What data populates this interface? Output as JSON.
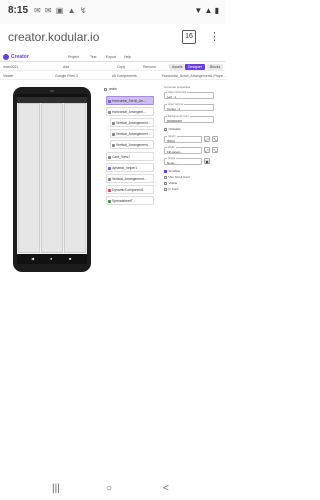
{
  "status_bar": {
    "time": "8:15",
    "left_icons": "✉ ✉ ▣ ▲ ↯",
    "right_icons": "▼ ▲ ▮"
  },
  "browser": {
    "url": "creator.kodular.io",
    "tab_count": "16",
    "more": "⋮"
  },
  "app": {
    "logo_text": "Creator",
    "menu": [
      "Project",
      "Test",
      "Export",
      "Help"
    ]
  },
  "toolbar": {
    "screen": "main2021",
    "items": [
      "Add",
      "Copy",
      "Remove"
    ],
    "buttons": [
      "Assets",
      "Designer",
      "Blocks"
    ],
    "accent": "#6a3fd8"
  },
  "subbar": {
    "viewer": "Viewer",
    "device": "Google Pixel 3",
    "components_filter": "All Components",
    "properties_title": "Horizontal_Scroll_Arrangement1 Prope..."
  },
  "tree": {
    "root": "main",
    "items": [
      {
        "label": "Horizontal_Scroll_Arr...",
        "icon_color": "#7a5fe0",
        "selected": true
      },
      {
        "label": "Horizontal_Arrangem...",
        "icon_color": "#8a8a8a",
        "selected": false
      },
      {
        "label": "Vertical_Arrangement...",
        "icon_color": "#8a8a8a",
        "selected": false
      },
      {
        "label": "Vertical_Arrangement...",
        "icon_color": "#8a8a8a",
        "selected": false
      },
      {
        "label": "Vertical_Arrangement...",
        "icon_color": "#8a8a8a",
        "selected": false
      },
      {
        "label": "Card_View1",
        "icon_color": "#8a8a8a",
        "selected": false
      },
      {
        "label": "dynamic_helper1",
        "icon_color": "#7a5fe0",
        "selected": false
      },
      {
        "label": "Vertical_Arrangement...",
        "icon_color": "#8a8a8a",
        "selected": false
      },
      {
        "label": "DynamicComponent1",
        "icon_color": "#e05050",
        "selected": false
      },
      {
        "label": "SpreadsheetT...",
        "icon_color": "#4a9a4a",
        "selected": false
      }
    ]
  },
  "properties": {
    "header": "Horizontal_Scroll_Arrangement1 Prope...",
    "section": "Common properties",
    "fields": [
      {
        "label": "Align Horizontal",
        "value": "Left : 1"
      },
      {
        "label": "Align Vertical",
        "value": "Center : 2"
      },
      {
        "label": "Background Color",
        "value": "#00000000"
      }
    ],
    "clickable_label": "Clickable",
    "height": {
      "label": "Height",
      "value": "300px"
    },
    "width": {
      "label": "Width",
      "value": "Fill parent..."
    },
    "image": {
      "label": "Image",
      "value": "None..."
    },
    "checkboxes": [
      {
        "label": "Scrollbar",
        "checked": true
      },
      {
        "label": "Use Scroll Card",
        "checked": false
      },
      {
        "label": "Visible",
        "checked": false
      },
      {
        "label": "In Card",
        "checked": false
      }
    ]
  },
  "bottom_nav": {
    "menu": "|||",
    "home": "○",
    "back": "<"
  }
}
